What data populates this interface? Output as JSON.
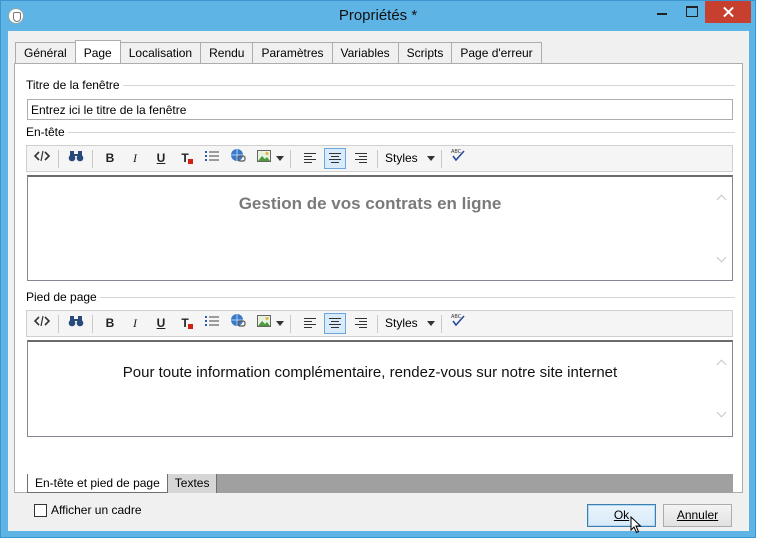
{
  "window": {
    "title": "Propriétés *"
  },
  "tabs": [
    {
      "label": "Général"
    },
    {
      "label": "Page"
    },
    {
      "label": "Localisation"
    },
    {
      "label": "Rendu"
    },
    {
      "label": "Paramètres"
    },
    {
      "label": "Variables"
    },
    {
      "label": "Scripts"
    },
    {
      "label": "Page d'erreur"
    }
  ],
  "active_tab": "Page",
  "window_title_section": {
    "label": "Titre de la fenêtre",
    "input_value": "Entrez ici le titre de la fenêtre"
  },
  "header_section": {
    "label": "En-tête",
    "content": "Gestion de vos contrats en ligne",
    "styles_label": "Styles"
  },
  "footer_section": {
    "label": "Pied de page",
    "content": "Pour toute information complémentaire, rendez-vous sur notre site internet",
    "styles_label": "Styles"
  },
  "toolbar_buttons": {
    "bold": "B",
    "italic": "I",
    "underline": "U",
    "font_color": "T"
  },
  "bottom_tabs": [
    {
      "label": "En-tête et pied de page"
    },
    {
      "label": "Textes"
    }
  ],
  "checkbox": {
    "label": "Afficher un cadre",
    "checked": false
  },
  "buttons": {
    "ok": "Ok",
    "cancel": "Annuler"
  },
  "colors": {
    "titlebar": "#5fb4e6",
    "close_button": "#c7402f",
    "header_text": "#7a7a7a",
    "selected_align": "#d9ebfa"
  }
}
